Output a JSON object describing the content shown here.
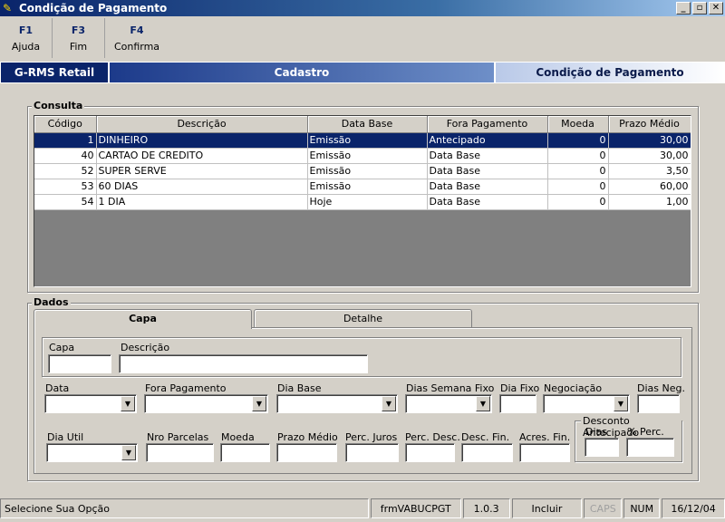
{
  "window": {
    "title": "Condição de Pagamento",
    "buttons": {
      "minimize": "_",
      "restore": "▫",
      "close": "✕"
    }
  },
  "fkeys": [
    {
      "key": "F1",
      "label": "Ajuda"
    },
    {
      "key": "F3",
      "label": "Fim"
    },
    {
      "key": "F4",
      "label": "Confirma"
    }
  ],
  "banner": {
    "app": "G-RMS Retail",
    "module": "Cadastro",
    "screen": "Condição de Pagamento"
  },
  "consulta": {
    "legend": "Consulta",
    "columns": [
      "Código",
      "Descrição",
      "Data Base",
      "Fora Pagamento",
      "Moeda",
      "Prazo Médio"
    ],
    "rows": [
      [
        "1",
        "DINHEIRO",
        "Emissão",
        "Antecipado",
        "0",
        "30,00"
      ],
      [
        "40",
        "CARTAO DE CREDITO",
        "Emissão",
        "Data Base",
        "0",
        "30,00"
      ],
      [
        "52",
        "SUPER SERVE",
        "Emissão",
        "Data Base",
        "0",
        "3,50"
      ],
      [
        "53",
        "60 DIAS",
        "Emissão",
        "Data Base",
        "0",
        "60,00"
      ],
      [
        "54",
        "1 DIA",
        "Hoje",
        "Data Base",
        "0",
        "1,00"
      ]
    ]
  },
  "dados": {
    "legend": "Dados",
    "tabs": {
      "capa": "Capa",
      "detalhe": "Detalhe"
    },
    "labels": {
      "capa": "Capa",
      "descricao": "Descrição",
      "data": "Data",
      "fora_pagamento": "Fora Pagamento",
      "dia_base": "Dia Base",
      "dias_semana_fixo": "Dias Semana Fixo",
      "dia_fixo": "Dia Fixo",
      "negociacao": "Negociação",
      "dias_neg": "Dias Neg.",
      "dia_util": "Dia Util",
      "nro_parcelas": "Nro Parcelas",
      "moeda": "Moeda",
      "prazo_medio": "Prazo Médio",
      "perc_juros": "Perc. Juros",
      "perc_desc": "Perc. Desc.",
      "desc_fin": "Desc. Fin.",
      "acres_fin": "Acres. Fin.",
      "desconto_antecipado": "Desconto Antecipado",
      "dias": "Dias",
      "perc": "% Perc."
    }
  },
  "status": {
    "message": "Selecione Sua Opção",
    "form": "frmVABUCPGT",
    "version": "1.0.3",
    "mode": "Incluir",
    "caps": "CAPS",
    "num": "NUM",
    "date": "16/12/04"
  }
}
